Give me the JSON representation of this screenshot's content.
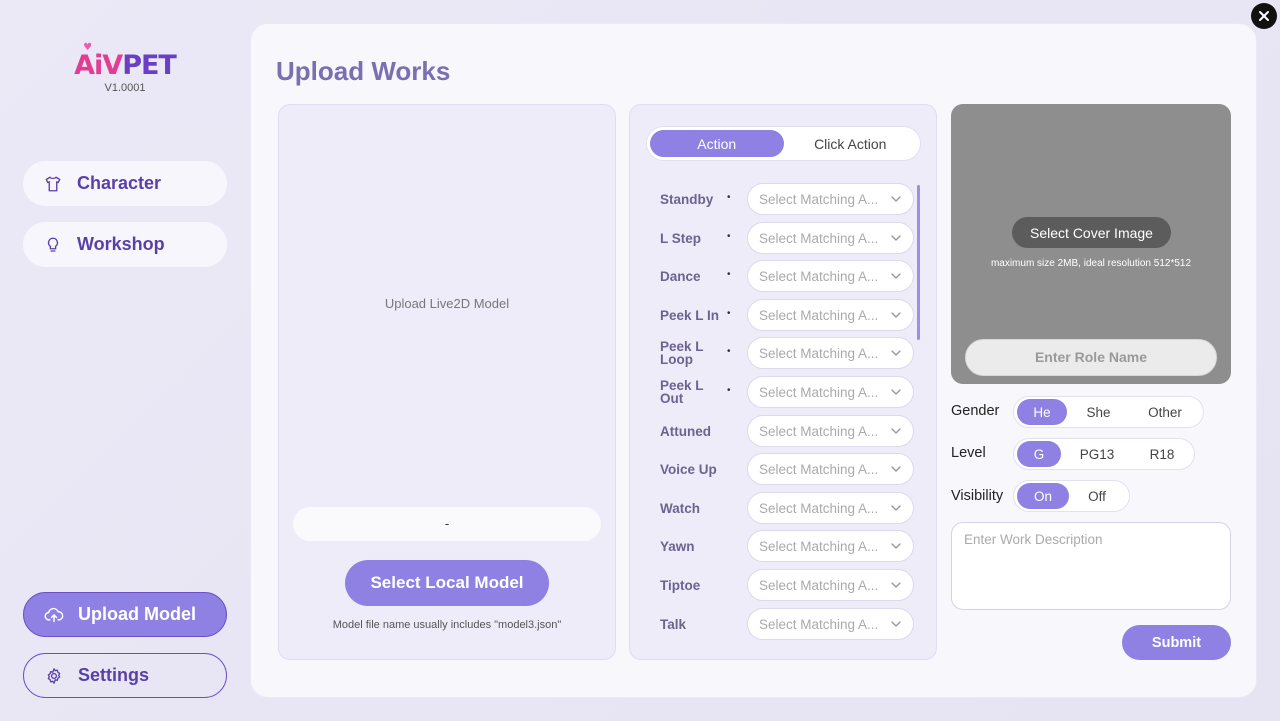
{
  "app": {
    "logo_pre": "A",
    "logo_i": "i",
    "logo_mid": "V",
    "logo_post": "PET",
    "version": "V1.0001"
  },
  "sidebar": {
    "top_items": [
      {
        "label": "Character",
        "icon": "tshirt-icon"
      },
      {
        "label": "Workshop",
        "icon": "lightbulb-icon"
      }
    ],
    "bottom_items": [
      {
        "label": "Upload Model",
        "icon": "cloud-upload-icon",
        "active": true
      },
      {
        "label": "Settings",
        "icon": "gear-icon",
        "active": false
      }
    ]
  },
  "page": {
    "title": "Upload Works"
  },
  "upload": {
    "placeholder": "Upload Live2D Model",
    "file_value": "-",
    "select_button": "Select Local Model",
    "hint": "Model file name usually includes \"model3.json\""
  },
  "actions": {
    "tabs": [
      {
        "label": "Action",
        "selected": true
      },
      {
        "label": "Click Action",
        "selected": false
      }
    ],
    "select_placeholder": "Select Matching A...",
    "items": [
      {
        "label": "Standby",
        "marker": "•"
      },
      {
        "label": "L Step",
        "marker": "•"
      },
      {
        "label": "Dance",
        "marker": "•"
      },
      {
        "label": "Peek L In",
        "marker": "•"
      },
      {
        "label": "Peek L Loop",
        "marker": "•"
      },
      {
        "label": "Peek L Out",
        "marker": "•"
      },
      {
        "label": "Attuned",
        "marker": ""
      },
      {
        "label": "Voice Up",
        "marker": ""
      },
      {
        "label": "Watch",
        "marker": ""
      },
      {
        "label": "Yawn",
        "marker": ""
      },
      {
        "label": "Tiptoe",
        "marker": ""
      },
      {
        "label": "Talk",
        "marker": ""
      }
    ]
  },
  "cover": {
    "button": "Select Cover Image",
    "hint": "maximum size 2MB, ideal resolution 512*512",
    "role_placeholder": "Enter Role Name"
  },
  "gender": {
    "label": "Gender",
    "options": [
      "He",
      "She",
      "Other"
    ],
    "selected": 0
  },
  "level": {
    "label": "Level",
    "options": [
      "G",
      "PG13",
      "R18"
    ],
    "selected": 0
  },
  "visibility": {
    "label": "Visibility",
    "options": [
      "On",
      "Off"
    ],
    "selected": 0
  },
  "description": {
    "placeholder": "Enter Work Description"
  },
  "submit": {
    "label": "Submit"
  },
  "colors": {
    "accent": "#8f80e3",
    "nav_text": "#5b3fa8",
    "cover_bg": "#8e8e8e"
  }
}
